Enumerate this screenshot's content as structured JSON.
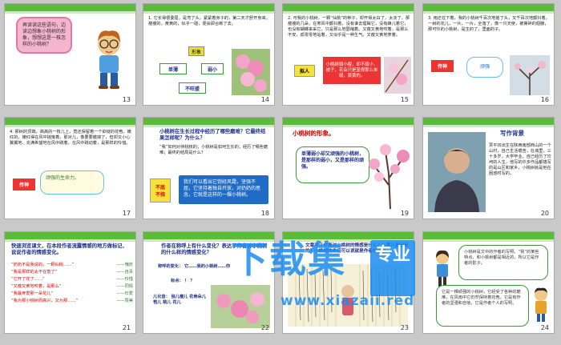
{
  "slides": [
    {
      "num": "13",
      "bubble": "再读读这些语句，边读边想象小桃树的形象，想想这是一株怎样的小桃树？"
    },
    {
      "num": "14",
      "body": "1. 它长得很委屈，是弯了头，紧紧着身子的，第二天才舒开身来。瘦瘦的，黄黄的，似乎一碰，便会即合断了去。",
      "box_top": "形象",
      "box_left": "单薄",
      "box_right": "弱小",
      "box_bottom": "不旺盛"
    },
    {
      "num": "15",
      "body": "2. 可我的小桃树，一颗“仙桃”的种子，却开得太白了，太淡了，那瘦瘦的几朵，在寒风中颤抖着，没有谁去理睬它，没有蜂儿着它，也没有蝴蝶来采它，只是那么地瑟缩着。又瘦又黄地咬着，是那么不安，孤零零地站着，又似乎是一种生气。又瘦又黄地笑着。",
      "box_left": "拟人",
      "box_right": "小桃树弱小瘦，却不弱小，被子，花朵只是显得那么单弱，黄黄的。"
    },
    {
      "num": "16",
      "body": "3. 雨还在下着，我的小桃树千百次地摇了头，又千百次地颤抖着。一树的花儿，一片，一片，全落了，像一只天使，被撕碎的翅膀，那可怜的小桃树，是生的了，里面的子。",
      "box_left": "传神",
      "bubble": "顽强"
    },
    {
      "num": "17",
      "body": "4. 那树的顶端，高高的一枝儿上，竟还保留着一个欲绽的花苞，嫩红的，嫩红得在风中摇曳着，那对儿，像要要撤掉了，但却又小心翼翼地、充满希望地在风中跳着，在风中跳动着，是那样的怜惜。",
      "box_left": "传神",
      "bubble": "顽强的生命力。"
    },
    {
      "num": "18",
      "title": "小桃树在生长过程中经历了哪些磨难？它最终结果怎样呢？为什么？",
      "body": "“我”如何对待桃核的；小桃树是如何生长的；经历了哪些磨难；最终的结局是什么？",
      "bubble": "我们可以看出它饱经风霜，坚强不屈，它坚持着独自开放，对奶奶的思念，它就是这样的一棵小桃树。",
      "box_left": "不屈\n不挠"
    },
    {
      "num": "19",
      "title": "小桃树的形象。",
      "bubble": "单薄弱小却又顽强的小桃树，是那样的弱小，又是那样的顽强。"
    },
    {
      "num": "20",
      "title": "写作背景",
      "body": "贾平凹出生在陕西南部商山的一个山村，自己生活艰苦，在城里，三十多岁，大学毕业，自己经历了坎坷的人生，他写的许多作品都描写的是山区和家乡，小桃树就是他在困惑时写的。"
    },
    {
      "num": "21",
      "title": "快速浏览课文，在本段作者流露情感的地方做标记，说说作者的情感变化。",
      "rows": [
        {
          "q": "“奶奶不是我说的，一颗仙桃……”",
          "a": "——愧疚"
        },
        {
          "q": "“我是那样的太不在意了”",
          "a": "——自责"
        },
        {
          "q": "“它开了花了……”",
          "a": "——怜惜"
        },
        {
          "q": "“又瘦又黄地咬着，是那么”",
          "a": "——同情"
        },
        {
          "q": "“我最疼爱那一朵花儿”",
          "a": "——珍爱"
        },
        {
          "q": "“我为那小桃树而高兴，又为那……”",
          "a": "——赞美"
        }
      ]
    },
    {
      "num": "22",
      "title": "作者在称呼上有什么变化？表达了作者对小桃树的什么样的情感变化？",
      "rows": [
        {
          "q": "称呼的变化：",
          "a": "它……我的小桃树……你"
        },
        {
          "q": "标点：",
          "a": "！  ？"
        },
        {
          "q": "儿化音：",
          "a": "独儿瘦儿 花骨朵儿 苞儿 桃儿 花儿"
        }
      ]
    },
    {
      "num": "23",
      "title": "文章写了作者对小桃树的情感是什么？从哪儿看出来的？小桃树的命运可以说就是作者的命运。"
    },
    {
      "num": "24",
      "bubble": "小桃树是文中的作者的写照。“我”的某些特点，和小桃树都是相近的，所以它是作者的影子。",
      "bubble2": "它是一棵顽强的小桃树，它经受了各种的磨难，在风雨中它仍然保持着花苞，它是有作者的坚强和自信，它是作者个人的写照。"
    }
  ],
  "watermark": {
    "title": "下载集",
    "site": "www.xiazaii.red",
    "stamp": "专业"
  }
}
